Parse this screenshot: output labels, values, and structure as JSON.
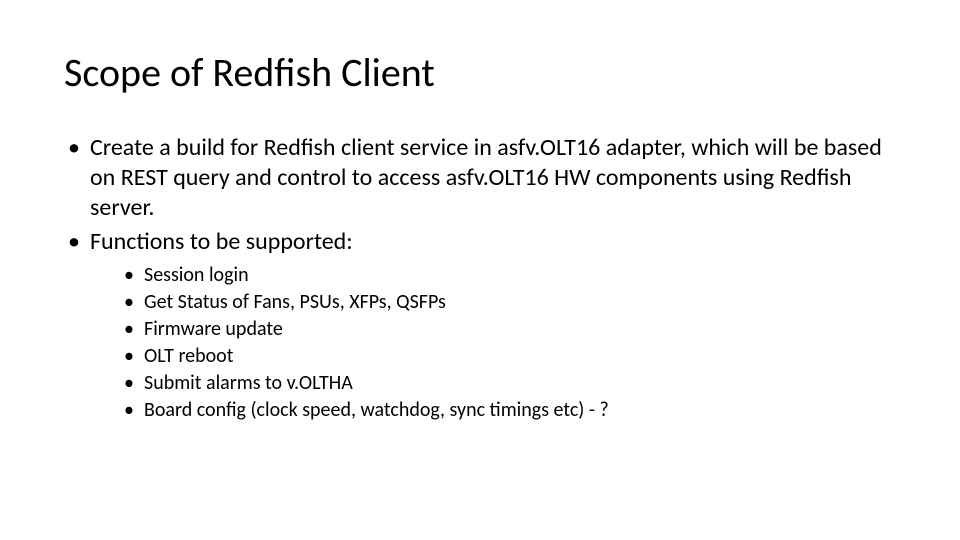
{
  "slide": {
    "title": "Scope of Redfish Client",
    "bullets": [
      {
        "text": "Create a build for Redfish client service in asfv.OLT16 adapter, which will be based on REST query and control to access asfv.OLT16 HW components using Redfish server."
      },
      {
        "text": "Functions to be supported:",
        "children": [
          "Session login",
          "Get Status of Fans, PSUs, XFPs, QSFPs",
          "Firmware update",
          "OLT reboot",
          "Submit alarms to v.OLTHA",
          "Board config (clock speed, watchdog, sync timings  etc) - ?"
        ]
      }
    ]
  }
}
